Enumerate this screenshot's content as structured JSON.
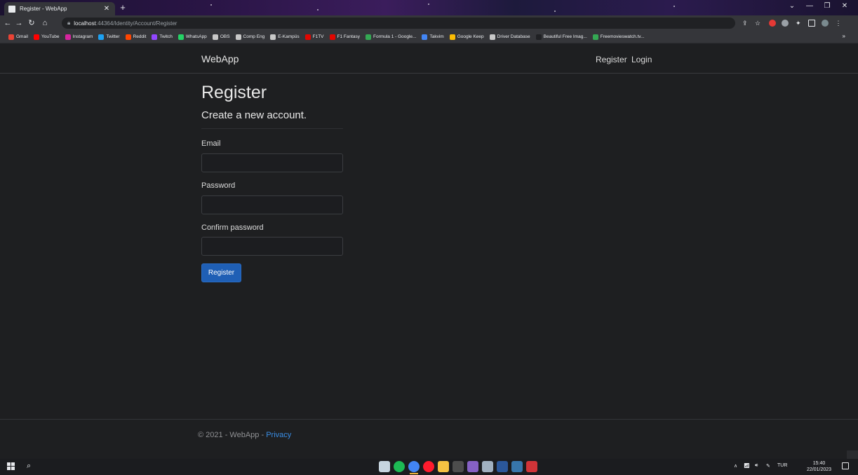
{
  "browser": {
    "tab_title": "Register - WebApp",
    "address_host": "localhost",
    "address_path": ":44364/Identity/Account/Register",
    "bookmarks": [
      {
        "label": "Gmail",
        "color": "#ea4335"
      },
      {
        "label": "YouTube",
        "color": "#ff0000"
      },
      {
        "label": "Instagram",
        "color": "#d6249f"
      },
      {
        "label": "Twitter",
        "color": "#1da1f2"
      },
      {
        "label": "Reddit",
        "color": "#ff4500"
      },
      {
        "label": "Twitch",
        "color": "#9146ff"
      },
      {
        "label": "WhatsApp",
        "color": "#25d366"
      },
      {
        "label": "OBS",
        "color": "#c8c8c8"
      },
      {
        "label": "Comp Eng",
        "color": "#c8c8c8"
      },
      {
        "label": "E-Kampüs",
        "color": "#c8c8c8"
      },
      {
        "label": "F1TV",
        "color": "#e10600"
      },
      {
        "label": "F1 Fantasy",
        "color": "#e10600"
      },
      {
        "label": "Formula 1 - Google...",
        "color": "#34a853"
      },
      {
        "label": "Takvim",
        "color": "#4285f4"
      },
      {
        "label": "Google Keep",
        "color": "#fbbc04"
      },
      {
        "label": "Driver Database",
        "color": "#c8c8c8"
      },
      {
        "label": "Beautiful Free Imag...",
        "color": "#202124"
      },
      {
        "label": "Freemovieswatch.tv...",
        "color": "#34a853"
      }
    ]
  },
  "site": {
    "brand": "WebApp",
    "nav": {
      "register": "Register",
      "login": "Login"
    }
  },
  "form": {
    "heading": "Register",
    "subheading": "Create a new account.",
    "email_label": "Email",
    "password_label": "Password",
    "confirm_label": "Confirm password",
    "email_value": "",
    "password_value": "",
    "confirm_value": "",
    "submit_label": "Register"
  },
  "footer": {
    "text": "© 2021 - WebApp - ",
    "privacy": "Privacy"
  },
  "taskbar": {
    "language": "TUR",
    "time": "15:40",
    "date": "22/01/2023",
    "apps": [
      {
        "name": "steam",
        "color": "#c7d5e0"
      },
      {
        "name": "spotify",
        "color": "#1db954"
      },
      {
        "name": "chrome",
        "color": "#4285f4"
      },
      {
        "name": "opera",
        "color": "#ff1b2d"
      },
      {
        "name": "file-explorer",
        "color": "#f5c242"
      },
      {
        "name": "terminal",
        "color": "#4d4d4d"
      },
      {
        "name": "visual-studio",
        "color": "#8661c5"
      },
      {
        "name": "app-generic",
        "color": "#a0b0c0"
      },
      {
        "name": "word",
        "color": "#2b579a"
      },
      {
        "name": "python",
        "color": "#3776ab"
      },
      {
        "name": "app-red",
        "color": "#d13438"
      }
    ]
  }
}
